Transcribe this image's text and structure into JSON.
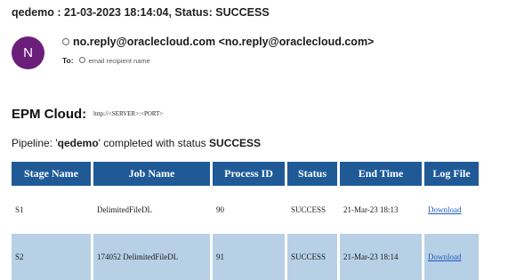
{
  "email": {
    "subject": "qedemo : 21-03-2023 18:14:04,  Status: SUCCESS",
    "avatar_initial": "N",
    "from": "no.reply@oraclecloud.com <no.reply@oraclecloud.com>",
    "to_label": "To:",
    "to_value": "email recipient name"
  },
  "body": {
    "epm_title": "EPM Cloud:",
    "server_url": "http://<SERVER>:<PORT>",
    "pipeline_prefix": "Pipeline: '",
    "pipeline_name": "qedemo",
    "pipeline_middle": "' completed with status ",
    "pipeline_status": "SUCCESS"
  },
  "table": {
    "headers": [
      "Stage Name",
      "Job Name",
      "Process ID",
      "Status",
      "End Time",
      "Log File"
    ],
    "rows": [
      [
        "S1",
        "DelimitedFileDL",
        "90",
        "SUCCESS",
        "21-Mar-23 18:13",
        "Download"
      ],
      [
        "S2",
        "174052 DelimitedFileDL",
        "91",
        "SUCCESS",
        "21-Mar-23 18:14",
        "Download"
      ]
    ]
  },
  "colors": {
    "avatar": "#6b1f7b",
    "header_bg": "#1f5a97",
    "alt_row": "#b7d0e6",
    "link": "#1f5bbf"
  }
}
